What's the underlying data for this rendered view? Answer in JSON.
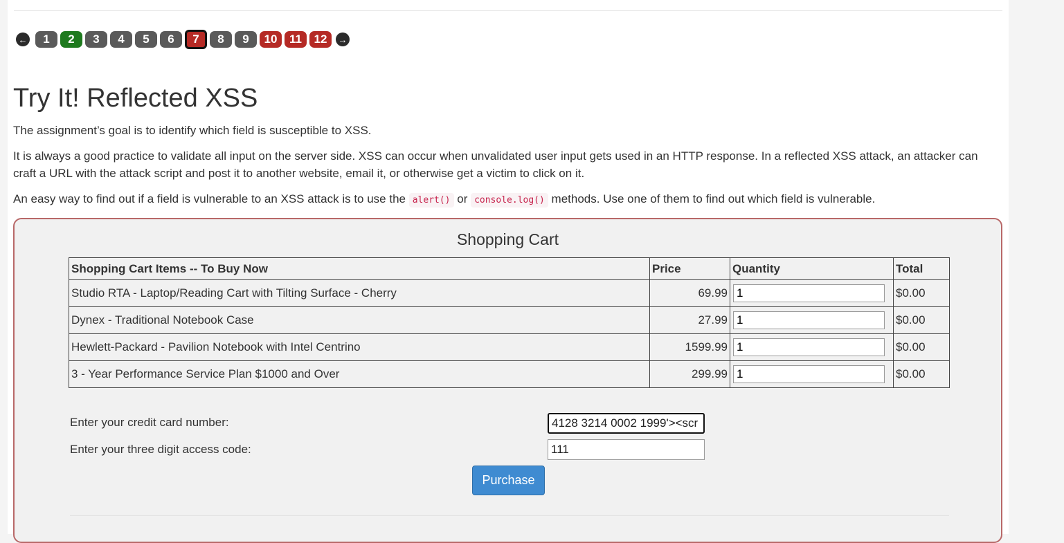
{
  "pager": {
    "prev_icon": "arrow-left-circle-icon",
    "next_icon": "arrow-right-circle-icon",
    "pages": [
      {
        "label": "1",
        "status": "default"
      },
      {
        "label": "2",
        "status": "solved"
      },
      {
        "label": "3",
        "status": "default"
      },
      {
        "label": "4",
        "status": "default"
      },
      {
        "label": "5",
        "status": "default"
      },
      {
        "label": "6",
        "status": "default"
      },
      {
        "label": "7",
        "status": "current"
      },
      {
        "label": "8",
        "status": "default"
      },
      {
        "label": "9",
        "status": "default"
      },
      {
        "label": "10",
        "status": "unsolved"
      },
      {
        "label": "11",
        "status": "unsolved"
      },
      {
        "label": "12",
        "status": "unsolved"
      }
    ],
    "colors": {
      "default": "#5a5a5a",
      "solved": "#1e7a1e",
      "unsolved": "#b52a25"
    }
  },
  "lesson": {
    "title": "Try It! Reflected XSS",
    "p1": "The assignment’s goal is to identify which field is susceptible to XSS.",
    "p2": "It is always a good practice to validate all input on the server side. XSS can occur when unvalidated user input gets used in an HTTP response. In a reflected XSS attack, an attacker can craft a URL with the attack script and post it to another website, email it, or otherwise get a victim to click on it.",
    "p3_before": "An easy way to find out if a field is vulnerable to an XSS attack is to use the ",
    "p3_code1": "alert()",
    "p3_mid": " or ",
    "p3_code2": "console.log()",
    "p3_after": " methods. Use one of them to find out which field is vulnerable."
  },
  "cart": {
    "title": "Shopping Cart",
    "headers": {
      "item": "Shopping Cart Items -- To Buy Now",
      "price": "Price",
      "quantity": "Quantity",
      "total": "Total"
    },
    "rows": [
      {
        "item": "Studio RTA - Laptop/Reading Cart with Tilting Surface - Cherry",
        "price": "69.99",
        "quantity": "1",
        "total": "$0.00"
      },
      {
        "item": "Dynex - Traditional Notebook Case",
        "price": "27.99",
        "quantity": "1",
        "total": "$0.00"
      },
      {
        "item": "Hewlett-Packard - Pavilion Notebook with Intel Centrino",
        "price": "1599.99",
        "quantity": "1",
        "total": "$0.00"
      },
      {
        "item": "3 - Year Performance Service Plan $1000 and Over",
        "price": "299.99",
        "quantity": "1",
        "total": "$0.00"
      }
    ]
  },
  "form": {
    "credit_card_label": "Enter your credit card number:",
    "credit_card_value": "4128 3214 0002 1999'><scr",
    "access_code_label": "Enter your three digit access code:",
    "access_code_value": "111",
    "purchase_label": "Purchase"
  }
}
